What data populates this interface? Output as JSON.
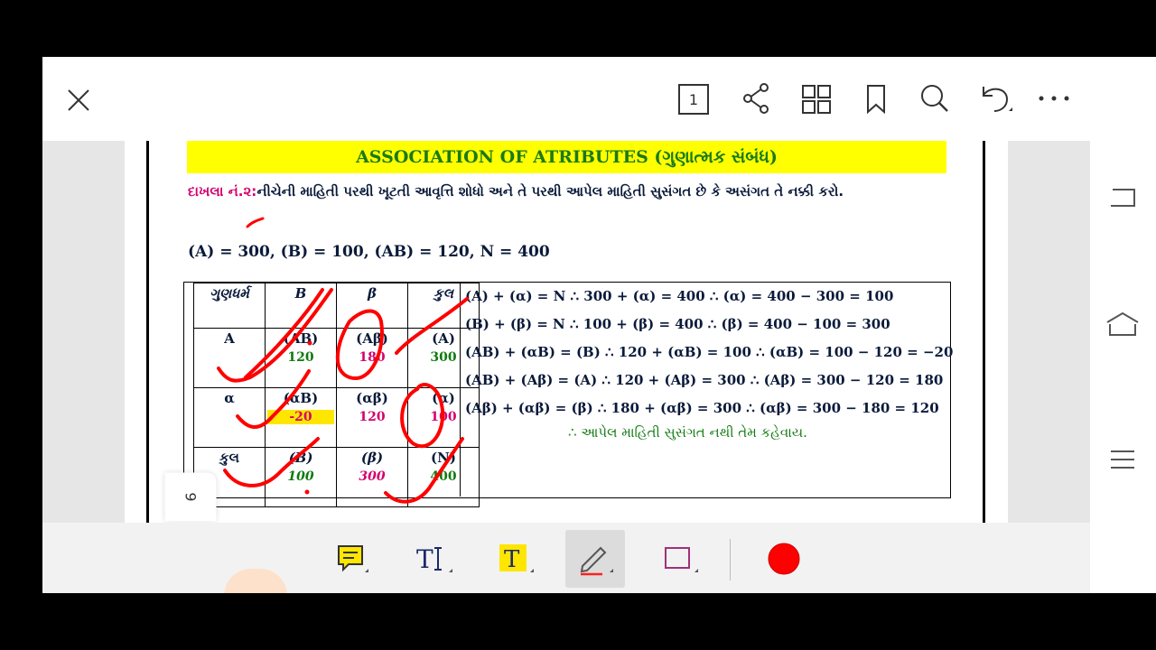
{
  "toolbar": {
    "page_number": "1",
    "icons": [
      "close-icon",
      "page-number-icon",
      "share-icon",
      "grid-view-icon",
      "bookmark-icon",
      "search-icon",
      "undo-icon",
      "more-icon"
    ]
  },
  "document": {
    "title": "ASSOCIATION OF ATRIBUTES (ગુણાત્મક સંબંધ)",
    "problem_tag": "દાખલા નં.૨:",
    "problem_text": "નીચેની માહિતી પરથી ખૂટતી આવૃત્તિ શોધો અને તે પરથી આપેલ માહિતી સુસંગત છે કે અસંગત તે નક્કી કરો.",
    "given": "(A) = 300, (B) = 100, (AB) = 120, N = 400",
    "table": {
      "headers": [
        "ગુણધર્મ",
        "B",
        "β",
        "કુલ"
      ],
      "rows": [
        {
          "label": "A",
          "cells": [
            {
              "sym": "(AB)",
              "val": "120"
            },
            {
              "sym": "(Aβ)",
              "val": "180"
            },
            {
              "sym": "(A)",
              "val": "300"
            }
          ]
        },
        {
          "label": "α",
          "cells": [
            {
              "sym": "(αB)",
              "val": "-20"
            },
            {
              "sym": "(αβ)",
              "val": "120"
            },
            {
              "sym": "(α)",
              "val": "100"
            }
          ]
        },
        {
          "label": "કુલ",
          "cells": [
            {
              "sym": "(B)",
              "val": "100"
            },
            {
              "sym": "(β)",
              "val": "300"
            },
            {
              "sym": "(N)",
              "val": "400"
            }
          ]
        }
      ]
    },
    "equations": [
      "(A) + (α) = N   ∴ 300 + (α) = 400    ∴ (α) = 400 − 300 = 100",
      "(B) + (β) = N  ∴ 100 + (β) = 400    ∴ (β) = 400 − 100 = 300",
      "(AB) + (αB) = (B) ∴ 120 + (αB) = 100  ∴ (αB) = 100 − 120 = −20",
      "(AB) + (Aβ) = (A)  ∴ 120 + (Aβ) = 300  ∴ (Aβ) = 300 − 120 = 180",
      "(Aβ) + (αβ) = (β) ∴ 180 + (αβ) = 300 ∴ (αβ) = 300 − 180 = 120"
    ],
    "conclusion": "∴ આપેલ માહિતી સુસંગત નથી તેમ કહેવાય.",
    "page_indicator": "9"
  },
  "annotation_tools": [
    "comment-tool-icon",
    "text-tool-icon",
    "highlight-text-tool-icon",
    "pen-tool-icon",
    "rectangle-tool-icon",
    "color-picker-icon"
  ],
  "colors": {
    "ink": "#ff0000",
    "highlight": "#ffff00",
    "accent_green": "#0f7a0f",
    "accent_pink": "#d4006e"
  }
}
